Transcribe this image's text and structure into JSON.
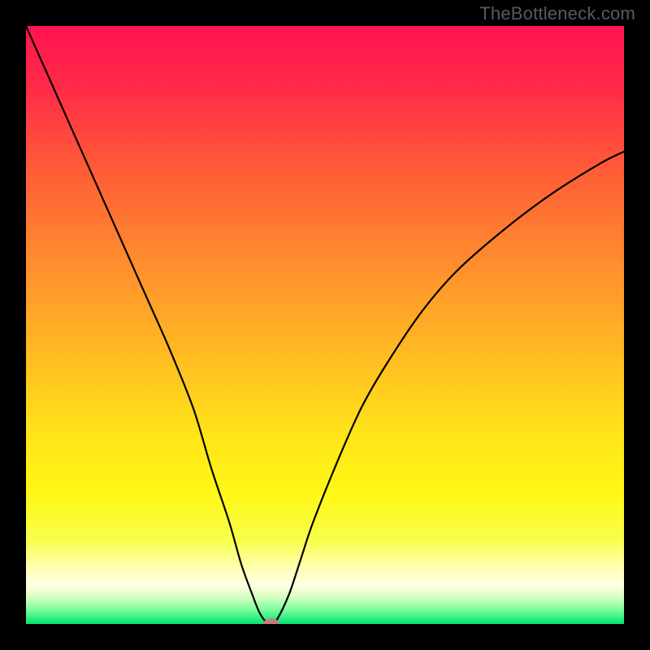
{
  "watermark": "TheBottleneck.com",
  "colors": {
    "frame": "#000000",
    "curve_stroke": "#000000",
    "marker_fill": "#c57d7a",
    "gradient_stops": [
      {
        "offset": 0.0,
        "color": "#ff1452"
      },
      {
        "offset": 0.1,
        "color": "#ff2a47"
      },
      {
        "offset": 0.25,
        "color": "#ff5f36"
      },
      {
        "offset": 0.4,
        "color": "#ff8e2d"
      },
      {
        "offset": 0.55,
        "color": "#ffbb22"
      },
      {
        "offset": 0.68,
        "color": "#ffe31a"
      },
      {
        "offset": 0.78,
        "color": "#fff714"
      },
      {
        "offset": 0.86,
        "color": "#f7ff4b"
      },
      {
        "offset": 0.905,
        "color": "#ffffb0"
      },
      {
        "offset": 0.935,
        "color": "#ffffe6"
      },
      {
        "offset": 0.955,
        "color": "#d8ffc0"
      },
      {
        "offset": 0.975,
        "color": "#7fff9e"
      },
      {
        "offset": 1.0,
        "color": "#00e472"
      }
    ]
  },
  "chart_data": {
    "type": "line",
    "title": "",
    "xlabel": "",
    "ylabel": "",
    "xlim": [
      0,
      100
    ],
    "ylim": [
      0,
      100
    ],
    "series": [
      {
        "name": "bottleneck-curve",
        "x": [
          0,
          4,
          8,
          12,
          16,
          20,
          24,
          28,
          31,
          34,
          36,
          38,
          39,
          40,
          41,
          42,
          44,
          46,
          48,
          52,
          56,
          60,
          66,
          72,
          80,
          88,
          96,
          100
        ],
        "y": [
          100,
          91,
          82,
          73,
          64,
          55,
          46,
          36,
          26,
          17,
          10,
          4.5,
          2.0,
          0.5,
          0.0,
          0.8,
          5.0,
          11,
          17,
          27,
          36,
          43,
          52,
          59,
          66,
          72,
          77,
          79
        ]
      }
    ],
    "marker": {
      "x": 41,
      "y": 0,
      "rx": 1.4,
      "ry": 0.9
    }
  }
}
